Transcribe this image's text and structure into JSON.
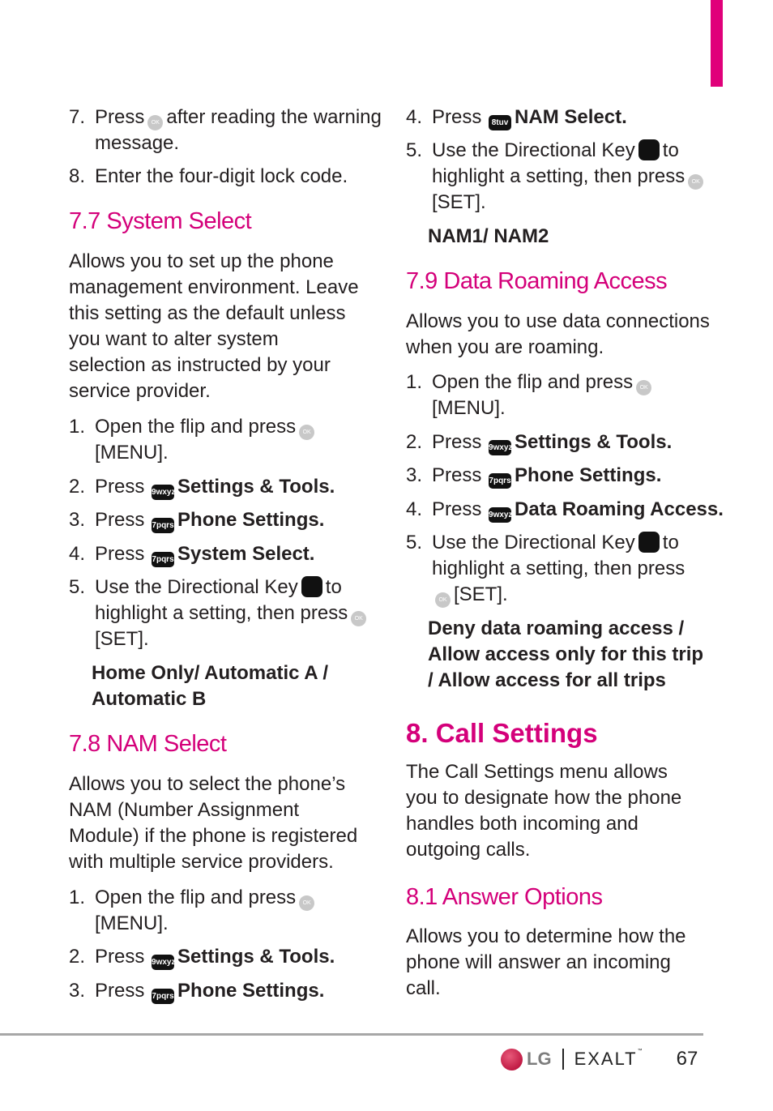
{
  "colors": {
    "heading": "#d4007a",
    "side_tab": "#e0007a"
  },
  "left": {
    "i7": {
      "num": "7.",
      "a": "Press",
      "b": "after reading the warning message."
    },
    "i8": {
      "num": "8.",
      "a": "Enter the four-digit lock code."
    },
    "s77": {
      "title": "7.7 System Select",
      "para": "Allows you to set up the phone management environment. Leave this setting as the default unless you want to alter system selection as instructed by your service provider.",
      "items": [
        {
          "num": "1.",
          "a": "Open the flip and press",
          "b": "[MENU]."
        },
        {
          "num": "2.",
          "a": "Press",
          "key": "9wxyz",
          "b": "Settings & Tools."
        },
        {
          "num": "3.",
          "a": "Press",
          "key": "7pqrs",
          "b": "Phone Settings."
        },
        {
          "num": "4.",
          "a": "Press",
          "key": "7pqrs",
          "b": "System Select."
        },
        {
          "num": "5.",
          "a": "Use the Directional Key",
          "c": "to highlight a setting, then press",
          "b": "[SET]."
        }
      ],
      "options": "Home Only/ Automatic A / Automatic B"
    },
    "s78": {
      "title": "7.8 NAM Select",
      "para": "Allows you to select the phone’s NAM (Number Assignment Module) if the phone is registered with multiple service providers.",
      "items": [
        {
          "num": "1.",
          "a": "Open the flip and press",
          "b": "[MENU]."
        },
        {
          "num": "2.",
          "a": "Press",
          "key": "9wxyz",
          "b": "Settings & Tools."
        },
        {
          "num": "3.",
          "a": "Press",
          "key": "7pqrs",
          "b": "Phone Settings."
        }
      ]
    }
  },
  "right": {
    "i4": {
      "num": "4.",
      "a": "Press",
      "key": "8tuv",
      "b": "NAM Select."
    },
    "i5": {
      "num": "5.",
      "a": "Use the Directional Key",
      "c": "to highlight a setting, then press",
      "b": "[SET]."
    },
    "nam_options": "NAM1/ NAM2",
    "s79": {
      "title": "7.9 Data Roaming Access",
      "para": "Allows you to use data connections when you are roaming.",
      "items": [
        {
          "num": "1.",
          "a": "Open the flip and press",
          "b": "[MENU]."
        },
        {
          "num": "2.",
          "a": "Press",
          "key": "9wxyz",
          "b": "Settings & Tools."
        },
        {
          "num": "3.",
          "a": "Press",
          "key": "7pqrs",
          "b": "Phone Settings."
        },
        {
          "num": "4.",
          "a": "Press",
          "key": "9wxyz",
          "b": "Data Roaming Access."
        },
        {
          "num": "5.",
          "a": "Use the Directional Key",
          "c": "to highlight a setting, then press",
          "b": "[SET]."
        }
      ],
      "options": "Deny data roaming access / Allow access only for this trip / Allow access for all trips"
    },
    "s8": {
      "title": "8. Call Settings",
      "para": "The Call Settings menu allows you to designate how the phone handles both incoming and outgoing calls."
    },
    "s81": {
      "title": "8.1 Answer Options",
      "para": "Allows you to determine how the phone will answer an incoming call."
    }
  },
  "footer": {
    "brand": "LG",
    "product": "EXALT",
    "tm": "™",
    "page": "67",
    "ok_label": "OK"
  }
}
